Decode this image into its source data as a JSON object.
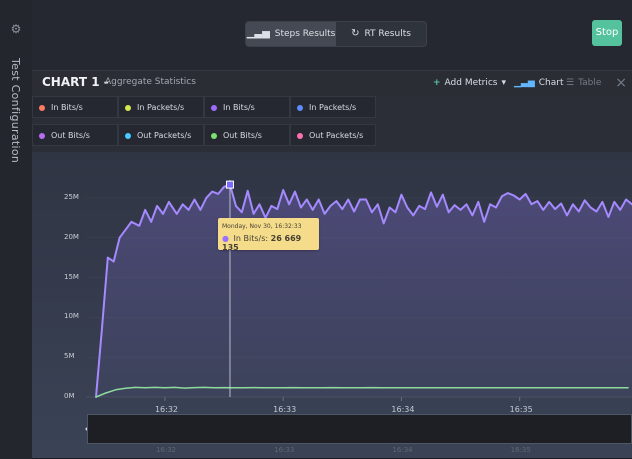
{
  "sidebar": {
    "label": "Test Configuration",
    "icon": "gear-icon"
  },
  "topbar": {
    "segments": [
      {
        "label": "Steps Results",
        "icon": "bar-chart-icon",
        "active": true
      },
      {
        "label": "RT Results",
        "icon": "refresh-icon",
        "active": false
      }
    ],
    "stop_label": "Stop"
  },
  "chart": {
    "title": "CHART 1 -",
    "subtitle": "Aggregate Statistics",
    "actions": {
      "add_metrics": "Add Metrics",
      "chart": "Chart",
      "table": "Table"
    }
  },
  "legend": [
    {
      "label": "In Bits/s",
      "color": "#ff7b62"
    },
    {
      "label": "In Packets/s",
      "color": "#d4ea4c"
    },
    {
      "label": "In Bits/s",
      "color": "#9d6cff"
    },
    {
      "label": "In Packets/s",
      "color": "#5e8cff"
    },
    {
      "label": "Out Bits/s",
      "color": "#b66df0"
    },
    {
      "label": "Out Packets/s",
      "color": "#49c9ff"
    },
    {
      "label": "Out Bits/s",
      "color": "#7ae06f"
    },
    {
      "label": "Out Packets/s",
      "color": "#ff6fb2"
    }
  ],
  "tooltip": {
    "date": "Monday, Nov 30, 16:32:33",
    "series": "In Bits/s:",
    "value": "26 669 135"
  },
  "chart_data": {
    "type": "line",
    "title": "",
    "xlabel": "",
    "ylabel": "",
    "ylim": [
      0,
      27000000
    ],
    "yticks": [
      "0M",
      "5M",
      "10M",
      "15M",
      "20M",
      "25M"
    ],
    "xticks": [
      "16:32",
      "16:33",
      "16:34",
      "16:35"
    ],
    "overview_ticks": [
      "16:32",
      "16:33",
      "16:34",
      "16:35"
    ],
    "x_start": "16:31:24",
    "x_end": "16:35:57",
    "series": [
      {
        "name": "In Bits/s",
        "color": "#a58aff",
        "points": [
          [
            "16:31:25",
            0
          ],
          [
            "16:31:28",
            8500000
          ],
          [
            "16:31:31",
            17500000
          ],
          [
            "16:31:34",
            17000000
          ],
          [
            "16:31:37",
            20000000
          ],
          [
            "16:31:40",
            21000000
          ],
          [
            "16:31:43",
            22000000
          ],
          [
            "16:31:47",
            21500000
          ],
          [
            "16:31:50",
            23500000
          ],
          [
            "16:31:53",
            22000000
          ],
          [
            "16:31:56",
            24000000
          ],
          [
            "16:31:59",
            23000000
          ],
          [
            "16:32:02",
            24500000
          ],
          [
            "16:32:06",
            23000000
          ],
          [
            "16:32:09",
            24200000
          ],
          [
            "16:32:12",
            23500000
          ],
          [
            "16:32:15",
            24800000
          ],
          [
            "16:32:18",
            23500000
          ],
          [
            "16:32:21",
            25000000
          ],
          [
            "16:32:24",
            25800000
          ],
          [
            "16:32:27",
            25500000
          ],
          [
            "16:32:30",
            26400000
          ],
          [
            "16:32:33",
            26669135
          ],
          [
            "16:32:36",
            24000000
          ],
          [
            "16:32:39",
            23200000
          ],
          [
            "16:32:42",
            25900000
          ],
          [
            "16:32:45",
            23000000
          ],
          [
            "16:32:48",
            24200000
          ],
          [
            "16:32:51",
            22500000
          ],
          [
            "16:32:54",
            24000000
          ],
          [
            "16:32:57",
            23600000
          ],
          [
            "16:33:00",
            26000000
          ],
          [
            "16:33:03",
            24200000
          ],
          [
            "16:33:06",
            25800000
          ],
          [
            "16:33:09",
            23800000
          ],
          [
            "16:33:12",
            24800000
          ],
          [
            "16:33:15",
            23500000
          ],
          [
            "16:33:18",
            24800000
          ],
          [
            "16:33:21",
            23000000
          ],
          [
            "16:33:24",
            24000000
          ],
          [
            "16:33:27",
            24600000
          ],
          [
            "16:33:30",
            23600000
          ],
          [
            "16:33:33",
            24800000
          ],
          [
            "16:33:36",
            23300000
          ],
          [
            "16:33:39",
            24800000
          ],
          [
            "16:33:42",
            24800000
          ],
          [
            "16:33:45",
            23200000
          ],
          [
            "16:33:48",
            24200000
          ],
          [
            "16:33:51",
            21800000
          ],
          [
            "16:33:54",
            23800000
          ],
          [
            "16:33:57",
            23200000
          ],
          [
            "16:34:00",
            25400000
          ],
          [
            "16:34:03",
            23800000
          ],
          [
            "16:34:06",
            22800000
          ],
          [
            "16:34:09",
            24000000
          ],
          [
            "16:34:12",
            23600000
          ],
          [
            "16:34:15",
            25700000
          ],
          [
            "16:34:18",
            23900000
          ],
          [
            "16:34:21",
            25400000
          ],
          [
            "16:34:24",
            23200000
          ],
          [
            "16:34:27",
            24100000
          ],
          [
            "16:34:30",
            23500000
          ],
          [
            "16:34:33",
            24200000
          ],
          [
            "16:34:36",
            22800000
          ],
          [
            "16:34:39",
            24500000
          ],
          [
            "16:34:42",
            22000000
          ],
          [
            "16:34:45",
            24200000
          ],
          [
            "16:34:48",
            23800000
          ],
          [
            "16:34:51",
            25200000
          ],
          [
            "16:34:54",
            25600000
          ],
          [
            "16:34:57",
            25300000
          ],
          [
            "16:35:00",
            24800000
          ],
          [
            "16:35:03",
            25500000
          ],
          [
            "16:35:06",
            24200000
          ],
          [
            "16:35:09",
            24600000
          ],
          [
            "16:35:12",
            23500000
          ],
          [
            "16:35:15",
            24500000
          ],
          [
            "16:35:18",
            23600000
          ],
          [
            "16:35:21",
            24300000
          ],
          [
            "16:35:24",
            22800000
          ],
          [
            "16:35:27",
            24200000
          ],
          [
            "16:35:30",
            23300000
          ],
          [
            "16:35:33",
            24700000
          ],
          [
            "16:35:36",
            23800000
          ],
          [
            "16:35:39",
            23300000
          ],
          [
            "16:35:42",
            24500000
          ],
          [
            "16:35:45",
            22600000
          ],
          [
            "16:35:48",
            24500000
          ],
          [
            "16:35:51",
            23500000
          ],
          [
            "16:35:54",
            24800000
          ],
          [
            "16:35:57",
            24200000
          ]
        ]
      },
      {
        "name": "Out Bits/s",
        "color": "#8ddc9d",
        "points": [
          [
            "16:31:25",
            0
          ],
          [
            "16:31:30",
            500000
          ],
          [
            "16:31:35",
            900000
          ],
          [
            "16:31:40",
            1100000
          ],
          [
            "16:31:45",
            1200000
          ],
          [
            "16:31:50",
            1150000
          ],
          [
            "16:31:55",
            1200000
          ],
          [
            "16:32:00",
            1150000
          ],
          [
            "16:32:05",
            1200000
          ],
          [
            "16:32:10",
            1120000
          ],
          [
            "16:32:15",
            1180000
          ],
          [
            "16:32:20",
            1200000
          ],
          [
            "16:32:25",
            1150000
          ],
          [
            "16:32:30",
            1180000
          ],
          [
            "16:32:35",
            1170000
          ],
          [
            "16:32:40",
            1150000
          ],
          [
            "16:32:45",
            1180000
          ],
          [
            "16:32:50",
            1160000
          ],
          [
            "16:32:55",
            1170000
          ],
          [
            "16:33:00",
            1150000
          ],
          [
            "16:33:05",
            1180000
          ],
          [
            "16:33:10",
            1150000
          ],
          [
            "16:33:15",
            1170000
          ],
          [
            "16:33:20",
            1160000
          ],
          [
            "16:33:25",
            1180000
          ],
          [
            "16:33:30",
            1150000
          ],
          [
            "16:33:35",
            1170000
          ],
          [
            "16:33:40",
            1160000
          ],
          [
            "16:33:45",
            1180000
          ],
          [
            "16:33:50",
            1150000
          ],
          [
            "16:33:55",
            1170000
          ],
          [
            "16:34:00",
            1160000
          ],
          [
            "16:34:05",
            1170000
          ],
          [
            "16:34:10",
            1150000
          ],
          [
            "16:34:15",
            1160000
          ],
          [
            "16:34:20",
            1170000
          ],
          [
            "16:34:25",
            1160000
          ],
          [
            "16:34:30",
            1170000
          ],
          [
            "16:34:35",
            1160000
          ],
          [
            "16:34:40",
            1170000
          ],
          [
            "16:34:45",
            1160000
          ],
          [
            "16:34:50",
            1170000
          ],
          [
            "16:34:55",
            1160000
          ],
          [
            "16:35:00",
            1170000
          ],
          [
            "16:35:05",
            1160000
          ],
          [
            "16:35:10",
            1170000
          ],
          [
            "16:35:15",
            1160000
          ],
          [
            "16:35:20",
            1170000
          ],
          [
            "16:35:25",
            1160000
          ],
          [
            "16:35:30",
            1170000
          ],
          [
            "16:35:35",
            1160000
          ],
          [
            "16:35:40",
            1170000
          ],
          [
            "16:35:45",
            1160000
          ],
          [
            "16:35:50",
            1170000
          ],
          [
            "16:35:55",
            1160000
          ]
        ]
      }
    ],
    "hover": {
      "x": "16:32:33",
      "series": "In Bits/s",
      "value": 26669135
    }
  }
}
